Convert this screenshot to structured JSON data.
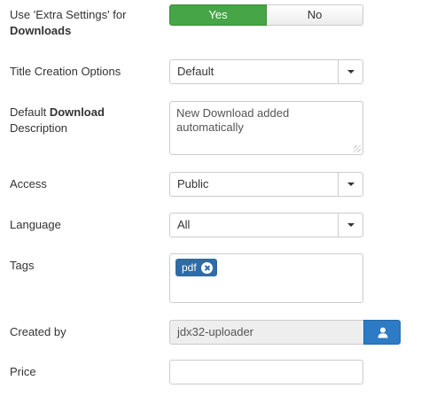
{
  "extra_settings": {
    "label_line1": "Use 'Extra Settings' for",
    "label_line2": "Downloads",
    "yes": "Yes",
    "no": "No"
  },
  "title_creation": {
    "label": "Title Creation Options",
    "value": "Default"
  },
  "default_description": {
    "label_prefix": "Default ",
    "label_bold": "Download",
    "label_line2": "Description",
    "value": "New Download added automatically"
  },
  "access": {
    "label": "Access",
    "value": "Public"
  },
  "language": {
    "label": "Language",
    "value": "All"
  },
  "tags": {
    "label": "Tags",
    "items": [
      "pdf"
    ]
  },
  "created_by": {
    "label": "Created by",
    "value": "jdx32-uploader"
  },
  "price": {
    "label": "Price",
    "value": ""
  },
  "colors": {
    "yes_green": "#46a546",
    "tag_blue": "#2f6ba4",
    "button_blue": "#2d7bc5"
  }
}
